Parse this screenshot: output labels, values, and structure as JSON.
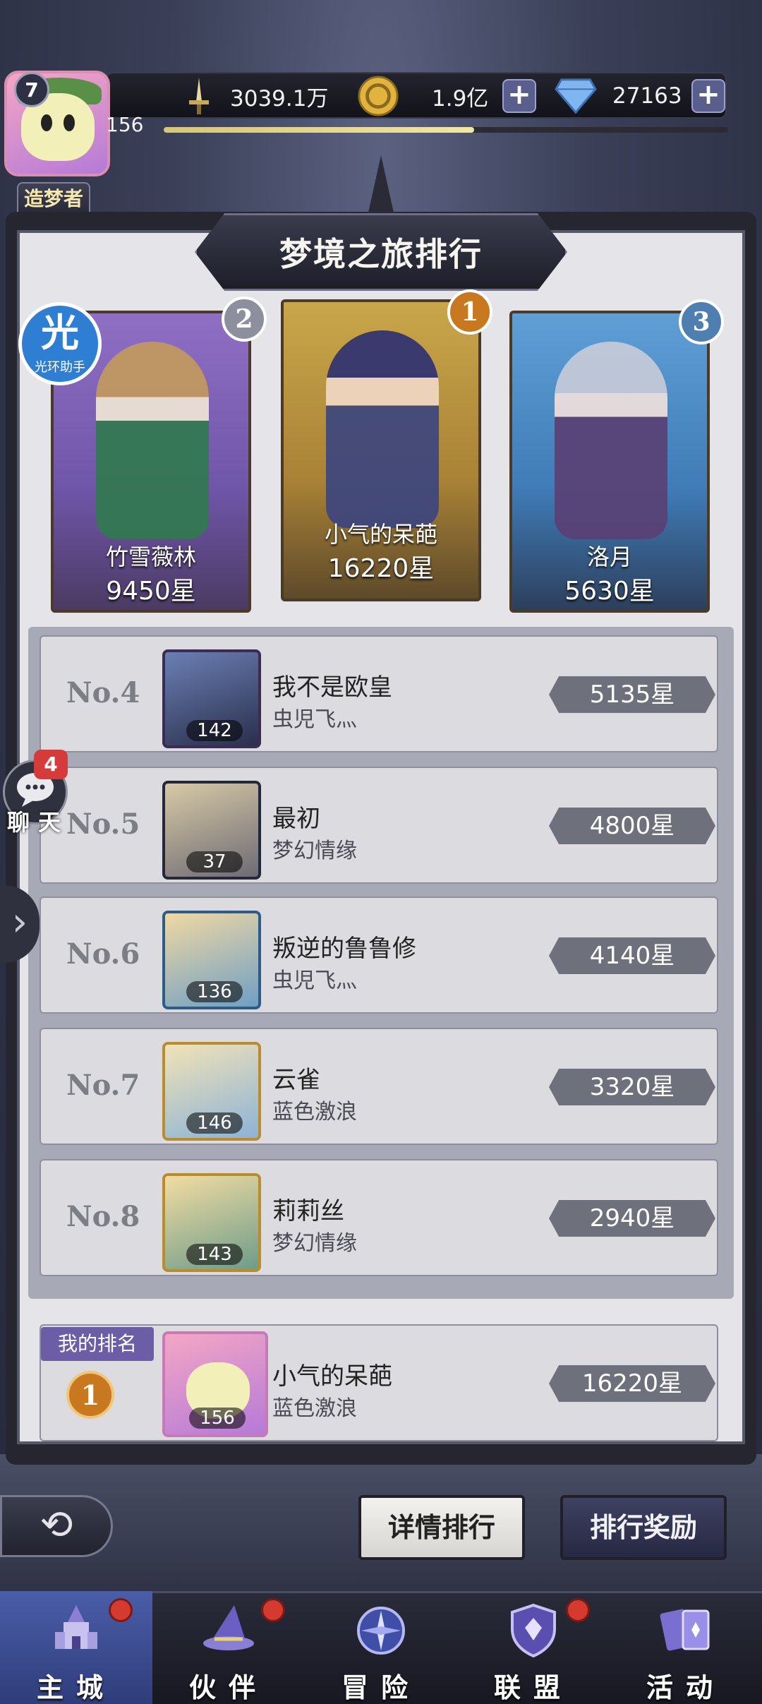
{
  "hud": {
    "vip_level": "7",
    "player_level": "156",
    "title_label": "造梦者",
    "title_stars": "✦✦✦✦✦",
    "xp_progress": 0.55,
    "power_value": "3039.1万",
    "gold_value": "1.9亿",
    "diamond_value": "27163",
    "plus_label": "+"
  },
  "panel": {
    "title": "梦境之旅排行"
  },
  "helper": {
    "glyph": "光",
    "label": "光环助手"
  },
  "podium": [
    {
      "rank": "2",
      "name": "竹雪薇林",
      "stars": "9450星"
    },
    {
      "rank": "1",
      "name": "小气的呆葩",
      "stars": "16220星"
    },
    {
      "rank": "3",
      "name": "洛月",
      "stars": "5630星"
    }
  ],
  "ranking": [
    {
      "rank": "No.4",
      "name": "我不是欧皇",
      "guild": "虫児飞灬",
      "level": "142",
      "stars": "5135星"
    },
    {
      "rank": "No.5",
      "name": "最初",
      "guild": "梦幻情缘",
      "level": "37",
      "stars": "4800星"
    },
    {
      "rank": "No.6",
      "name": "叛逆的鲁鲁修",
      "guild": "虫児飞灬",
      "level": "136",
      "stars": "4140星"
    },
    {
      "rank": "No.7",
      "name": "云雀",
      "guild": "蓝色激浪",
      "level": "146",
      "stars": "3320星"
    },
    {
      "rank": "No.8",
      "name": "莉莉丝",
      "guild": "梦幻情缘",
      "level": "143",
      "stars": "2940星"
    }
  ],
  "my_rank": {
    "label": "我的排名",
    "rank": "1",
    "name": "小气的呆葩",
    "guild": "蓝色激浪",
    "level": "156",
    "stars": "16220星"
  },
  "chat": {
    "badge": "4",
    "label": "聊天"
  },
  "buttons": {
    "back": "⟲",
    "detail": "详情排行",
    "reward": "排行奖励"
  },
  "nav": [
    {
      "label": "主城"
    },
    {
      "label": "伙伴"
    },
    {
      "label": "冒险"
    },
    {
      "label": "联盟"
    },
    {
      "label": "活动"
    }
  ],
  "colors": {
    "accent_gold": "#c8781f",
    "panel_bg": "#e5e4e8",
    "nav_active": "#4a5da8"
  }
}
